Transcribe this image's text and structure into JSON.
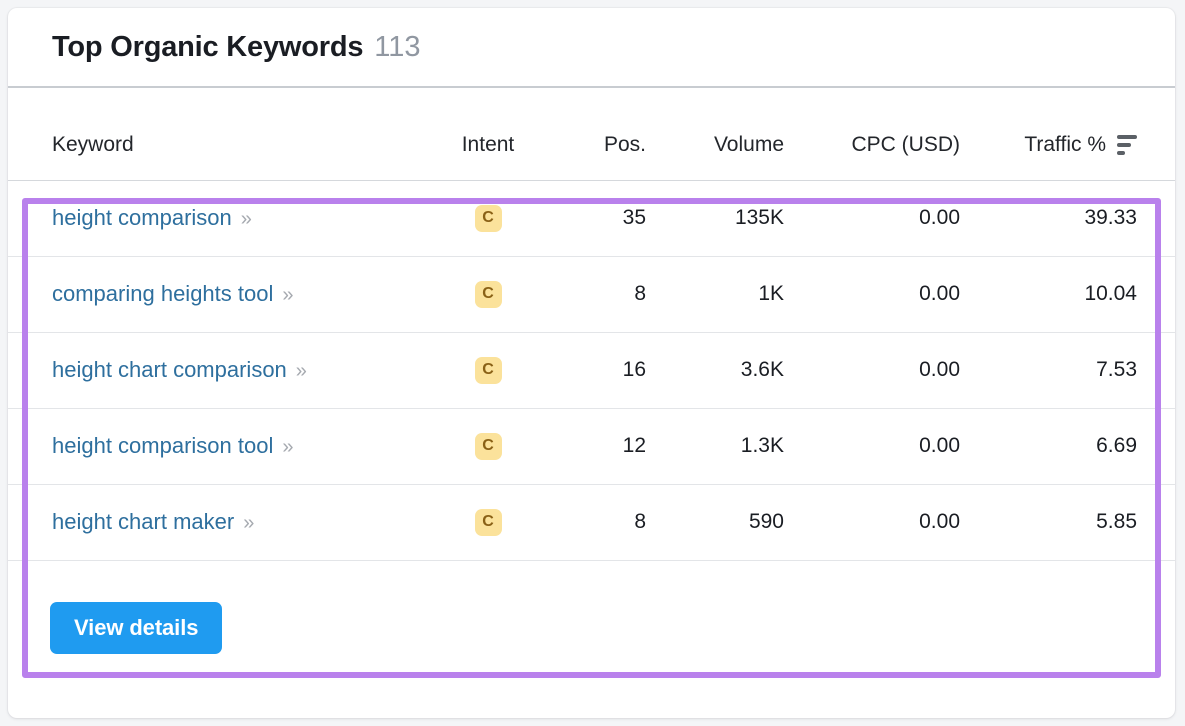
{
  "card": {
    "title": "Top Organic Keywords",
    "count": "113"
  },
  "table": {
    "columns": {
      "keyword": "Keyword",
      "intent": "Intent",
      "pos": "Pos.",
      "volume": "Volume",
      "cpc": "CPC (USD)",
      "traffic": "Traffic %"
    },
    "sort_icon": "sort-descending-icon",
    "row_link_icon": "double-chevron-right-icon",
    "rows": [
      {
        "keyword": "height comparison",
        "chevrons": "»",
        "intent": "C",
        "pos": "35",
        "volume": "135K",
        "cpc": "0.00",
        "traffic": "39.33"
      },
      {
        "keyword": "comparing heights tool",
        "chevrons": "»",
        "intent": "C",
        "pos": "8",
        "volume": "1K",
        "cpc": "0.00",
        "traffic": "10.04"
      },
      {
        "keyword": "height chart comparison",
        "chevrons": "»",
        "intent": "C",
        "pos": "16",
        "volume": "3.6K",
        "cpc": "0.00",
        "traffic": "7.53"
      },
      {
        "keyword": "height comparison tool",
        "chevrons": "»",
        "intent": "C",
        "pos": "12",
        "volume": "1.3K",
        "cpc": "0.00",
        "traffic": "6.69"
      },
      {
        "keyword": "height chart maker",
        "chevrons": "»",
        "intent": "C",
        "pos": "8",
        "volume": "590",
        "cpc": "0.00",
        "traffic": "5.85"
      }
    ]
  },
  "footer": {
    "view_details_label": "View details"
  },
  "colors": {
    "highlight_border": "#b981ec",
    "button_blue": "#1f9bf0",
    "link_blue": "#2e6f9e",
    "intent_badge_bg": "#fbe29b",
    "intent_badge_text": "#8a6116",
    "count_gray": "#9097a1"
  }
}
